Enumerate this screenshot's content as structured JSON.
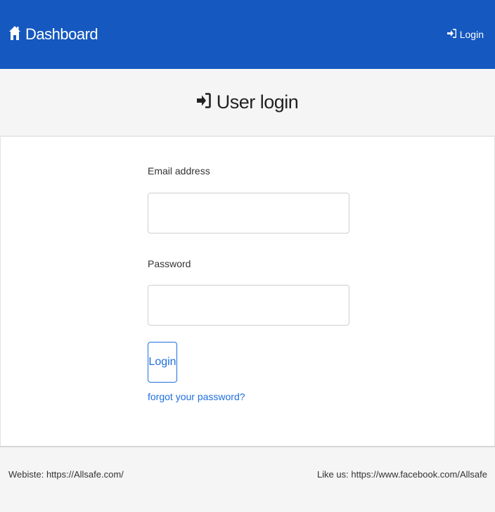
{
  "navbar": {
    "brand_icon": "home-icon",
    "brand_label": "Dashboard",
    "login_icon": "sign-in-icon",
    "login_label": "Login",
    "background_color": "#1558bf"
  },
  "header": {
    "icon": "sign-in-icon",
    "title": "User login"
  },
  "form": {
    "email_label": "Email address",
    "email_value": "",
    "password_label": "Password",
    "password_value": "",
    "submit_label": "Login",
    "forgot_label": "forgot your password?",
    "accent_color": "#1f6fe0"
  },
  "footer": {
    "website": "Webiste: https://Allsafe.com/",
    "social": "Like us: https://www.facebook.com/Allsafe"
  }
}
